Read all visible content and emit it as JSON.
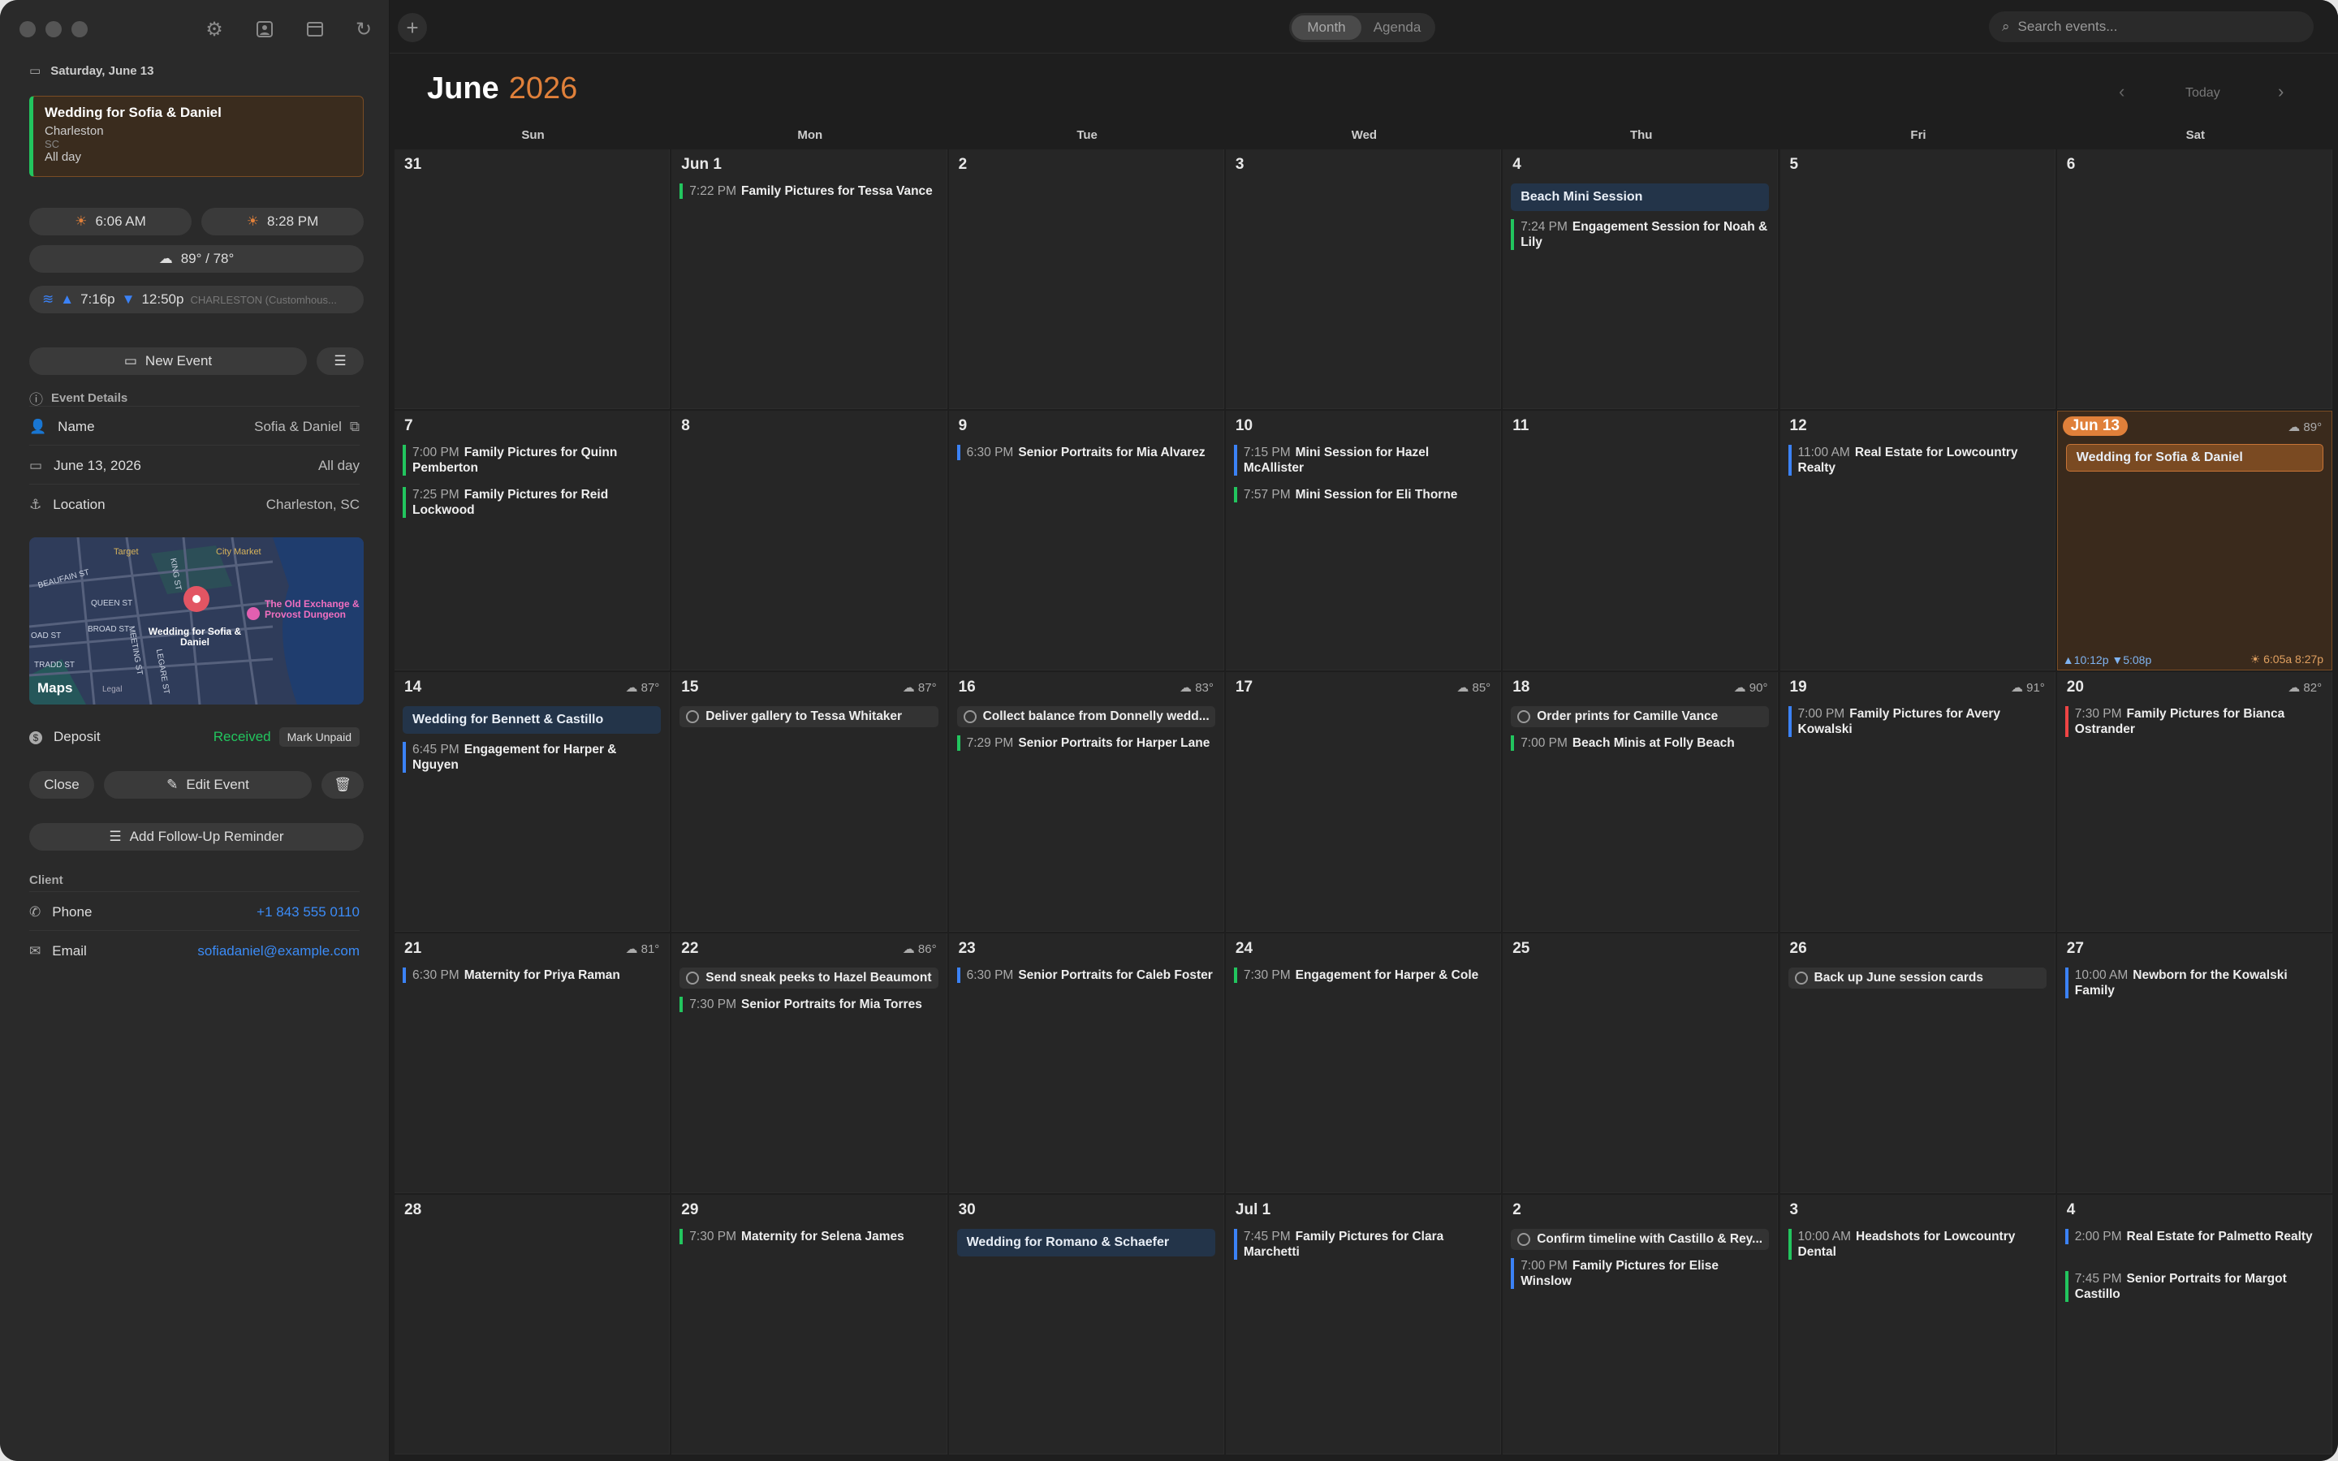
{
  "toolbar": {
    "month_label": "Month",
    "agenda_label": "Agenda",
    "search_placeholder": "Search events...",
    "today_label": "Today"
  },
  "header": {
    "month": "June",
    "year": "2026"
  },
  "weekdays": [
    "Sun",
    "Mon",
    "Tue",
    "Wed",
    "Thu",
    "Fri",
    "Sat"
  ],
  "sidebar": {
    "date_header": "Saturday, June 13",
    "selected_event": {
      "title": "Wedding for Sofia & Daniel",
      "city": "Charleston",
      "state": "SC",
      "when": "All day"
    },
    "sunrise": "6:06 AM",
    "sunset": "8:28 PM",
    "temps": "89° / 78°",
    "tides": {
      "high": "7:16p",
      "low": "12:50p",
      "station": "CHARLESTON (Customhous..."
    },
    "new_event": "New Event",
    "details_header": "Event Details",
    "name_label": "Name",
    "name_value": "Sofia & Daniel",
    "date_value": "June 13, 2026",
    "date_right": "All day",
    "location_label": "Location",
    "location_value": "Charleston, SC",
    "map": {
      "streets": [
        "BEAUFAIN ST",
        "QUEEN ST",
        "BROAD ST",
        "KING ST",
        "MEETING ST",
        "LEGARE ST",
        "TRADD ST",
        "OAD ST"
      ],
      "poi_target": "Target",
      "poi_market": "City Market",
      "poi_exchange": "The Old Exchange & Provost Dungeon",
      "pin_label": "Wedding for Sofia & Daniel",
      "maps_label": "Maps",
      "legal": "Legal"
    },
    "deposit_label": "Deposit",
    "deposit_status": "Received",
    "mark_unpaid": "Mark Unpaid",
    "close": "Close",
    "edit_event": "Edit Event",
    "follow_up": "Add Follow-Up Reminder",
    "client_header": "Client",
    "phone_label": "Phone",
    "phone_value": "+1 843 555 0110",
    "email_label": "Email",
    "email_value": "sofiadaniel@example.com"
  },
  "weeks": [
    [
      {
        "d": "31",
        "items": []
      },
      {
        "d": "Jun 1",
        "items": [
          {
            "type": "ev",
            "time": "7:22 PM",
            "title": "Family Pictures for Tessa Vance",
            "color": "#22c55e"
          }
        ]
      },
      {
        "d": "2",
        "items": []
      },
      {
        "d": "3",
        "items": []
      },
      {
        "d": "4",
        "items": [
          {
            "type": "allday",
            "title": "Beach Mini Session"
          },
          {
            "type": "ev",
            "time": "7:24 PM",
            "title": "Engagement Session for Noah & Lily",
            "color": "#22c55e"
          }
        ]
      },
      {
        "d": "5",
        "items": []
      },
      {
        "d": "6",
        "items": []
      }
    ],
    [
      {
        "d": "7",
        "items": [
          {
            "type": "ev",
            "time": "7:00 PM",
            "title": "Family Pictures for Quinn Pemberton",
            "color": "#22c55e"
          },
          {
            "type": "ev",
            "time": "7:25 PM",
            "title": "Family Pictures for Reid Lockwood",
            "color": "#22c55e"
          }
        ]
      },
      {
        "d": "8",
        "items": []
      },
      {
        "d": "9",
        "items": [
          {
            "type": "ev",
            "time": "6:30 PM",
            "title": "Senior Portraits for Mia Alvarez",
            "color": "#3b82f6"
          }
        ]
      },
      {
        "d": "10",
        "items": [
          {
            "type": "ev",
            "time": "7:15 PM",
            "title": "Mini Session for Hazel McAllister",
            "color": "#3b82f6"
          },
          {
            "type": "ev",
            "time": "7:57 PM",
            "title": "Mini Session for Eli Thorne",
            "color": "#22c55e"
          }
        ]
      },
      {
        "d": "11",
        "items": []
      },
      {
        "d": "12",
        "items": [
          {
            "type": "ev",
            "time": "11:00 AM",
            "title": "Real Estate for Lowcountry Realty",
            "color": "#3b82f6"
          }
        ]
      },
      {
        "d": "Jun 13",
        "today": true,
        "wx": "89°",
        "items": [
          {
            "type": "wedding",
            "title": "Wedding for Sofia & Daniel"
          }
        ],
        "tide": "▲10:12p  ▼5:08p",
        "sun": "6:05a  8:27p"
      }
    ],
    [
      {
        "d": "14",
        "wx": "87°",
        "items": [
          {
            "type": "allday",
            "title": "Wedding for Bennett & Castillo"
          },
          {
            "type": "ev",
            "time": "6:45 PM",
            "title": "Engagement for Harper & Nguyen",
            "color": "#3b82f6"
          }
        ]
      },
      {
        "d": "15",
        "wx": "87°",
        "items": [
          {
            "type": "task",
            "title": "Deliver gallery to Tessa Whitaker"
          }
        ]
      },
      {
        "d": "16",
        "wx": "83°",
        "items": [
          {
            "type": "task",
            "title": "Collect balance from Donnelly wedd..."
          },
          {
            "type": "ev",
            "time": "7:29 PM",
            "title": "Senior Portraits for Harper Lane",
            "color": "#22c55e"
          }
        ]
      },
      {
        "d": "17",
        "wx": "85°",
        "items": []
      },
      {
        "d": "18",
        "wx": "90°",
        "items": [
          {
            "type": "task",
            "title": "Order prints for Camille Vance"
          },
          {
            "type": "ev",
            "time": "7:00 PM",
            "title": "Beach Minis at Folly Beach",
            "color": "#22c55e"
          }
        ]
      },
      {
        "d": "19",
        "wx": "91°",
        "items": [
          {
            "type": "ev",
            "time": "7:00 PM",
            "title": "Family Pictures for Avery Kowalski",
            "color": "#3b82f6"
          }
        ]
      },
      {
        "d": "20",
        "wx": "82°",
        "items": [
          {
            "type": "ev",
            "time": "7:30 PM",
            "title": "Family Pictures for Bianca Ostrander",
            "color": "#ef4444"
          }
        ]
      }
    ],
    [
      {
        "d": "21",
        "wx": "81°",
        "items": [
          {
            "type": "ev",
            "time": "6:30 PM",
            "title": "Maternity for Priya Raman",
            "color": "#3b82f6"
          }
        ]
      },
      {
        "d": "22",
        "wx": "86°",
        "items": [
          {
            "type": "task",
            "title": "Send sneak peeks to Hazel Beaumont"
          },
          {
            "type": "ev",
            "time": "7:30 PM",
            "title": "Senior Portraits for Mia Torres",
            "color": "#22c55e"
          }
        ]
      },
      {
        "d": "23",
        "items": [
          {
            "type": "ev",
            "time": "6:30 PM",
            "title": "Senior Portraits for Caleb Foster",
            "color": "#3b82f6"
          }
        ]
      },
      {
        "d": "24",
        "items": [
          {
            "type": "ev",
            "time": "7:30 PM",
            "title": "Engagement for Harper & Cole",
            "color": "#22c55e"
          }
        ]
      },
      {
        "d": "25",
        "items": []
      },
      {
        "d": "26",
        "items": [
          {
            "type": "task",
            "title": "Back up June session cards"
          }
        ]
      },
      {
        "d": "27",
        "items": [
          {
            "type": "ev",
            "time": "10:00 AM",
            "title": "Newborn for the Kowalski Family",
            "color": "#3b82f6"
          }
        ]
      }
    ],
    [
      {
        "d": "28",
        "items": []
      },
      {
        "d": "29",
        "items": [
          {
            "type": "ev",
            "time": "7:30 PM",
            "title": "Maternity for Selena James",
            "color": "#22c55e"
          }
        ]
      },
      {
        "d": "30",
        "items": [
          {
            "type": "allday",
            "title": "Wedding for Romano & Schaefer"
          }
        ]
      },
      {
        "d": "Jul 1",
        "items": [
          {
            "type": "ev",
            "time": "7:45 PM",
            "title": "Family Pictures for Clara Marchetti",
            "color": "#3b82f6"
          }
        ]
      },
      {
        "d": "2",
        "items": [
          {
            "type": "task",
            "title": "Confirm timeline with Castillo & Rey..."
          },
          {
            "type": "ev",
            "time": "7:00 PM",
            "title": "Family Pictures for Elise Winslow",
            "color": "#3b82f6"
          }
        ]
      },
      {
        "d": "3",
        "items": [
          {
            "type": "ev",
            "time": "10:00 AM",
            "title": "Headshots for Lowcountry Dental",
            "color": "#22c55e"
          }
        ]
      },
      {
        "d": "4",
        "items": [
          {
            "type": "ev",
            "time": "2:00 PM",
            "title": "Real Estate for Palmetto Realty",
            "color": "#3b82f6"
          },
          {
            "type": "ev",
            "time": "7:45 PM",
            "title": "Senior Portraits for Margot Castillo",
            "color": "#22c55e"
          }
        ]
      }
    ]
  ]
}
